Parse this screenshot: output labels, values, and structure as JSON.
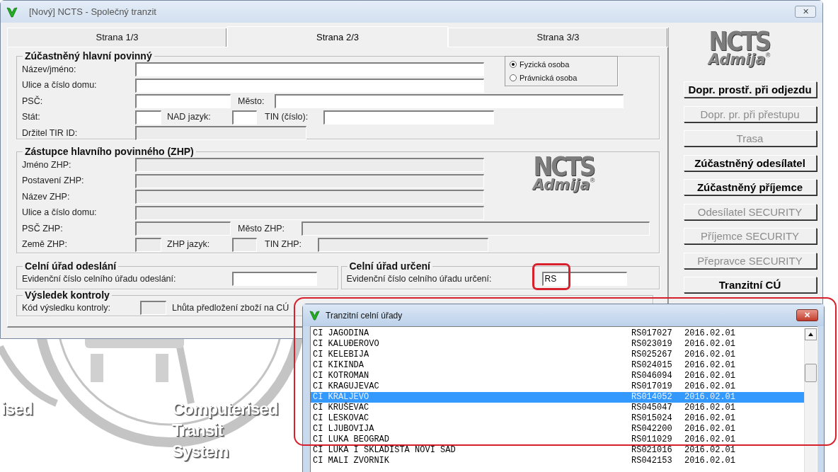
{
  "window": {
    "title": "[Nový]  NCTS - Společný tranzit",
    "close": "✕"
  },
  "tabs": [
    {
      "label": "Strana 1/3",
      "selected": false
    },
    {
      "label": "Strana 2/3",
      "selected": true
    },
    {
      "label": "Strana 3/3",
      "selected": false
    }
  ],
  "principal": {
    "title": "Zúčastněný hlavní povinný",
    "rows": [
      {
        "items": [
          {
            "kind": "label",
            "text": "Název/jméno:"
          },
          {
            "kind": "input",
            "disabled": false
          }
        ]
      },
      {
        "items": [
          {
            "kind": "label",
            "text": "Ulice a číslo domu:"
          },
          {
            "kind": "input",
            "disabled": false
          }
        ]
      },
      {
        "items": [
          {
            "kind": "label",
            "text": "PSČ:"
          },
          {
            "kind": "input",
            "disabled": false
          },
          {
            "kind": "label",
            "text": "Město:"
          },
          {
            "kind": "input",
            "disabled": false
          }
        ]
      },
      {
        "items": [
          {
            "kind": "label",
            "text": "Stát:"
          },
          {
            "kind": "input",
            "disabled": false
          },
          {
            "kind": "label",
            "text": "NAD jazyk:"
          },
          {
            "kind": "input",
            "disabled": false
          },
          {
            "kind": "label",
            "text": "TIN (číslo):"
          },
          {
            "kind": "input",
            "disabled": false
          }
        ]
      },
      {
        "items": [
          {
            "kind": "label",
            "text": "Držitel TIR ID:"
          },
          {
            "kind": "input",
            "disabled": true
          }
        ]
      }
    ],
    "person_type": [
      {
        "label": "Fyzická osoba",
        "selected": true
      },
      {
        "label": "Právnická osoba",
        "selected": false
      }
    ]
  },
  "representative": {
    "title": "Zástupce hlavního povinného (ZHP)",
    "rows": [
      {
        "items": [
          {
            "kind": "label",
            "text": "Jméno ZHP:"
          },
          {
            "kind": "input",
            "disabled": true
          }
        ]
      },
      {
        "items": [
          {
            "kind": "label",
            "text": "Postavení ZHP:"
          },
          {
            "kind": "input",
            "disabled": true
          }
        ]
      },
      {
        "items": [
          {
            "kind": "label",
            "text": "Název ZHP:"
          },
          {
            "kind": "input",
            "disabled": true
          }
        ]
      },
      {
        "items": [
          {
            "kind": "label",
            "text": "Ulice a číslo domu:"
          },
          {
            "kind": "input",
            "disabled": true
          }
        ]
      },
      {
        "items": [
          {
            "kind": "label",
            "text": "PSČ ZHP:"
          },
          {
            "kind": "input",
            "disabled": true
          },
          {
            "kind": "label",
            "text": "Město ZHP:"
          },
          {
            "kind": "input",
            "disabled": true
          }
        ]
      },
      {
        "items": [
          {
            "kind": "label",
            "text": "Země ZHP:"
          },
          {
            "kind": "input",
            "disabled": true
          },
          {
            "kind": "label",
            "text": "ZHP jazyk:"
          },
          {
            "kind": "input",
            "disabled": true
          },
          {
            "kind": "label",
            "text": "TIN ZHP:"
          },
          {
            "kind": "input",
            "disabled": true
          }
        ]
      }
    ]
  },
  "departure_office": {
    "title": "Celní úřad odeslání",
    "label": "Evidenční číslo celního úřadu odeslání:"
  },
  "destination_office": {
    "title": "Celní úřad určení",
    "label": "Evidenční číslo celního úřadu určení:",
    "value": "RS"
  },
  "control_result": {
    "title": "Výsledek kontroly",
    "code_label": "Kód výsledku kontroly:",
    "deadline_label": "Lhůta předložení zboží na CÚ"
  },
  "logos": [
    {
      "top": "NCTS",
      "bottom": "Admija",
      "mark": "®"
    },
    {
      "top": "NCTS",
      "bottom": "Admija",
      "mark": "®"
    }
  ],
  "side_buttons": [
    {
      "label": "Dopr. prostř. při odjezdu",
      "disabled": false
    },
    {
      "label": "Dopr. pr. při přestupu",
      "disabled": true
    },
    {
      "label": "Trasa",
      "disabled": true
    },
    {
      "label": "Zúčastněný odesílatel",
      "disabled": false
    },
    {
      "label": "Zúčastněný příjemce",
      "disabled": false
    },
    {
      "label": "Odesílatel SECURITY",
      "disabled": true
    },
    {
      "label": "Příjemce SECURITY",
      "disabled": true
    },
    {
      "label": "Přepravce SECURITY",
      "disabled": true
    },
    {
      "label": "Tranzitní CÚ",
      "disabled": false
    }
  ],
  "background_logo": {
    "lines": [
      "ised",
      "Computerised",
      "Transit",
      "System"
    ]
  },
  "dialog": {
    "title": "Tranzitní celní úřady",
    "close": "✕",
    "rows": [
      {
        "name": "CI JAGODINA",
        "code": "RS017027",
        "date": "2016.02.01",
        "selected": false
      },
      {
        "name": "CI KALUĐEROVO",
        "code": "RS023019",
        "date": "2016.02.01",
        "selected": false
      },
      {
        "name": "CI KELEBIJA",
        "code": "RS025267",
        "date": "2016.02.01",
        "selected": false
      },
      {
        "name": "CI KIKINDA",
        "code": "RS024015",
        "date": "2016.02.01",
        "selected": false
      },
      {
        "name": "CI KOTROMAN",
        "code": "RS046094",
        "date": "2016.02.01",
        "selected": false
      },
      {
        "name": "CI KRAGUJEVAC",
        "code": "RS017019",
        "date": "2016.02.01",
        "selected": false
      },
      {
        "name": "CI KRALJEVO",
        "code": "RS014052",
        "date": "2016.02.01",
        "selected": true
      },
      {
        "name": "CI KRUŠEVAC",
        "code": "RS045047",
        "date": "2016.02.01",
        "selected": false
      },
      {
        "name": "CI LESKOVAC",
        "code": "RS015024",
        "date": "2016.02.01",
        "selected": false
      },
      {
        "name": "CI LJUBOVIJA",
        "code": "RS042200",
        "date": "2016.02.01",
        "selected": false
      },
      {
        "name": "CI LUKA BEOGRAD",
        "code": "RS011029",
        "date": "2016.02.01",
        "selected": false
      },
      {
        "name": "CI LUKA I SKLADIŠTA NOVI SAD",
        "code": "RS021016",
        "date": "2016.02.01",
        "selected": false
      },
      {
        "name": "CI MALI ZVORNIK",
        "code": "RS042153",
        "date": "2016.02.01",
        "selected": false
      }
    ]
  }
}
